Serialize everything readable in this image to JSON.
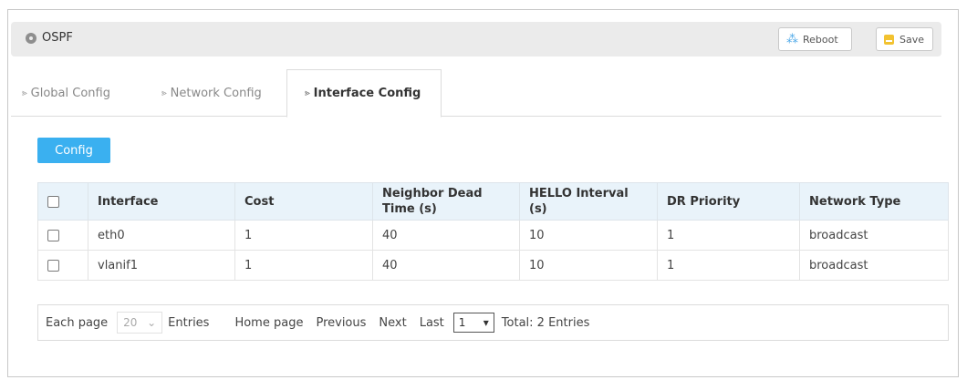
{
  "header": {
    "title": "OSPF",
    "reboot_label": "Reboot",
    "save_label": "Save"
  },
  "tabs": [
    {
      "label": "Global Config"
    },
    {
      "label": "Network Config"
    },
    {
      "label": "Interface Config"
    }
  ],
  "toolbar": {
    "config_label": "Config"
  },
  "table": {
    "columns": [
      "Interface",
      "Cost",
      "Neighbor Dead Time (s)",
      "HELLO Interval (s)",
      "DR Priority",
      "Network Type"
    ],
    "rows": [
      [
        "eth0",
        "1",
        "40",
        "10",
        "1",
        "broadcast"
      ],
      [
        "vlanif1",
        "1",
        "40",
        "10",
        "1",
        "broadcast"
      ]
    ]
  },
  "pager": {
    "each_page": "Each page",
    "page_size": "20",
    "entries": "Entries",
    "home": "Home page",
    "previous": "Previous",
    "next": "Next",
    "last": "Last",
    "current_page": "1",
    "total": "Total: 2 Entries"
  },
  "colors": {
    "accent": "#3ab0f0",
    "header_bg": "#e9f3fa",
    "titlebar_bg": "#ebebeb",
    "save_icon": "#f2c230",
    "reboot_icon": "#4fa9e8"
  }
}
